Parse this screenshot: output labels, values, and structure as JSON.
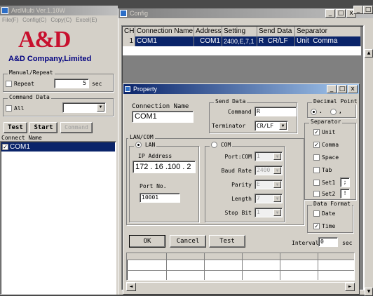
{
  "main_window": {
    "title": "ArdMulti Ver.1.10W",
    "menu": [
      "File(F)",
      "Config(C)",
      "Copy(C)",
      "Excel(E)"
    ],
    "logo_text": "A&D",
    "company": "A&D Company,Limited",
    "manual_repeat": {
      "label": "Manual/Repeat",
      "repeat_label": "Repeat",
      "repeat_value": "5",
      "unit": "sec"
    },
    "command_data": {
      "label": "Command Data",
      "all_label": "All"
    },
    "buttons": {
      "test": "Test",
      "start": "Start",
      "command": "Command"
    },
    "connect_name": {
      "label": "Connect Name",
      "items": [
        "COM1"
      ]
    }
  },
  "config_window": {
    "title": "Config",
    "columns": [
      "CH",
      "Connection Name",
      "Address",
      "Setting",
      "Send Data",
      "Separator"
    ],
    "rows": [
      [
        "1",
        "COM1",
        "COM1",
        "2400,E,7,1",
        "R  CR/LF",
        "Unit  Comma"
      ]
    ]
  },
  "property_dialog": {
    "title": "Property",
    "connection_name": {
      "label": "Connection Name",
      "value": "COM1"
    },
    "send_data": {
      "label": "Send Data",
      "command_label": "Command",
      "command_value": "R",
      "terminator_label": "Terminator",
      "terminator_value": "CR/LF"
    },
    "lan_com": {
      "label": "LAN/COM",
      "lan_label": "LAN",
      "com_label": "COM",
      "ip_label": "IP Address",
      "ip_value": "172 . 16 .100 . 2",
      "port_label": "Port No.",
      "port_value": "10001",
      "com_fields": [
        {
          "label": "Port:COM",
          "value": "1"
        },
        {
          "label": "Baud Rate",
          "value": "2400"
        },
        {
          "label": "Parity",
          "value": "E"
        },
        {
          "label": "Length",
          "value": "7"
        },
        {
          "label": "Stop Bit",
          "value": "1"
        }
      ]
    },
    "decimal_point": {
      "label": "Decimal Point",
      "options": [
        ".",
        ","
      ]
    },
    "separator": {
      "label": "Separator",
      "items": [
        {
          "label": "Unit",
          "checked": true
        },
        {
          "label": "Comma",
          "checked": true
        },
        {
          "label": "Space",
          "checked": false
        },
        {
          "label": "Tab",
          "checked": false
        },
        {
          "label": "Set1",
          "checked": false,
          "value": ";"
        },
        {
          "label": "Set2",
          "checked": false,
          "value": "!"
        }
      ]
    },
    "data_format": {
      "label": "Data Format",
      "items": [
        {
          "label": "Date",
          "checked": false
        },
        {
          "label": "Time",
          "checked": true
        }
      ]
    },
    "buttons": {
      "ok": "OK",
      "cancel": "Cancel",
      "test": "Test"
    },
    "interval": {
      "label": "Interval",
      "value": "0",
      "unit": "sec"
    }
  },
  "glyphs": {
    "check": "✓",
    "min": "_",
    "max": "□",
    "close": "x",
    "down": "▼",
    "up": "▲",
    "left": "◄",
    "right": "►"
  }
}
